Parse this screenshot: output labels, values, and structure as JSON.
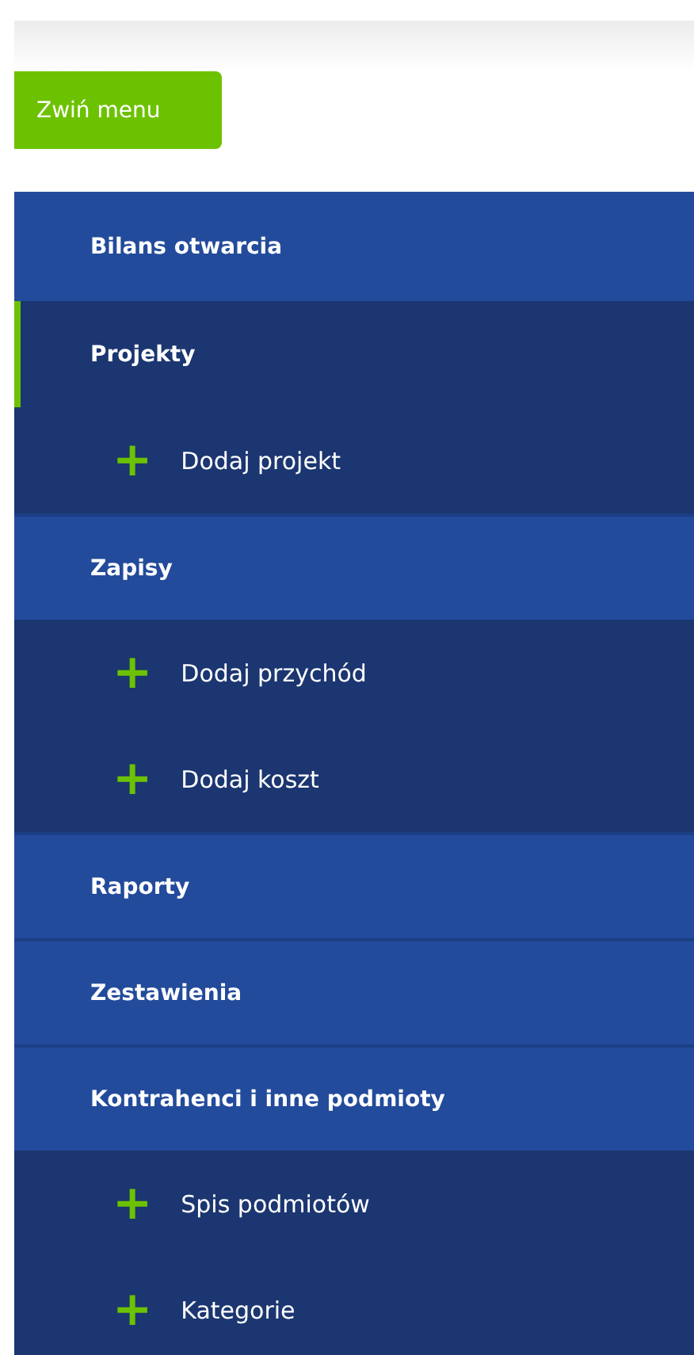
{
  "collapse_button": {
    "label": "Zwiń menu"
  },
  "menu": [
    {
      "label": "Bilans otwarcia",
      "selected": false
    },
    {
      "label": "Projekty",
      "selected": true,
      "children": [
        {
          "icon": "+",
          "label": "Dodaj projekt"
        }
      ]
    },
    {
      "label": "Zapisy",
      "selected": false,
      "children": [
        {
          "icon": "+",
          "label": "Dodaj przychód"
        },
        {
          "icon": "+",
          "label": "Dodaj koszt"
        }
      ]
    },
    {
      "label": "Raporty",
      "selected": false
    },
    {
      "label": "Zestawienia",
      "selected": false
    },
    {
      "label": "Kontrahenci i inne podmioty",
      "selected": false,
      "children": [
        {
          "icon": "+",
          "label": "Spis podmiotów"
        },
        {
          "icon": "+",
          "label": "Kategorie"
        }
      ]
    }
  ]
}
